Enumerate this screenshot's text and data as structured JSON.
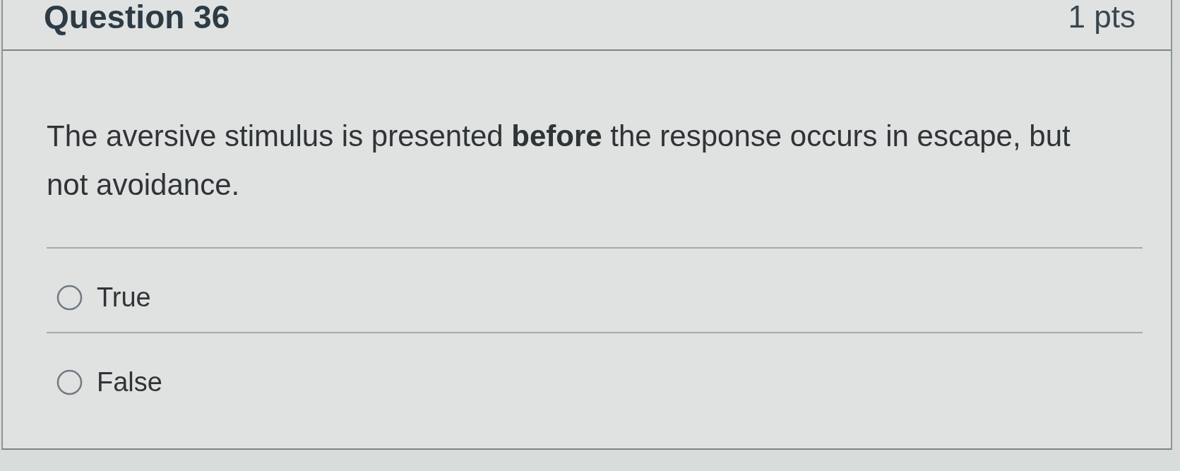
{
  "question": {
    "title": "Question 36",
    "points": "1 pts"
  },
  "prompt": "The aversive stimulus is presented **before** the response occurs in escape, but not avoidance.",
  "answers": [
    {
      "label": "True",
      "selected": false
    },
    {
      "label": "False",
      "selected": false
    }
  ]
}
